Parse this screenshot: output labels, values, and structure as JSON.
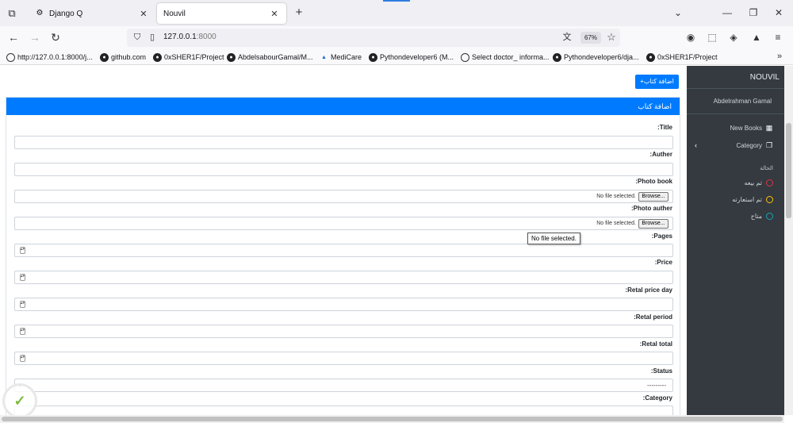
{
  "browser": {
    "tabs": [
      {
        "title": "Django Q",
        "active": false
      },
      {
        "title": "Nouvil",
        "active": true
      }
    ],
    "url_host": "127.0.0.1",
    "url_port": ":8000",
    "zoom": "67%",
    "bookmarks": [
      "http://127.0.0.1:8000/j...",
      "github.com",
      "0xSHER1F/Project",
      "AbdelsabourGamal/M...",
      "MediCare",
      "Pythondeveloper6 (M...",
      "Select doctor_ informa...",
      "Pythondeveloper6/dja...",
      "0xSHER1F/Project"
    ]
  },
  "sidebar": {
    "brand": "NOUVIL",
    "user": "Abdelrahman Gamal",
    "menu": [
      {
        "label": "New Books",
        "icon": "grid-icon"
      },
      {
        "label": "Category",
        "icon": "copy-icon"
      }
    ],
    "section_title": "الحالة",
    "legend": [
      {
        "label": "تم بيعه",
        "color": "#dc3545"
      },
      {
        "label": "تم استعارته",
        "color": "#ffc107"
      },
      {
        "label": "متاح",
        "color": "#17a2b8"
      }
    ]
  },
  "main": {
    "add_button": "+اضافة كتاب",
    "card_title": "اضافة كتاب",
    "fields": {
      "title": ":Title",
      "auther": ":Auther",
      "photo_book": ":Photo book",
      "photo_auther": ":Photo auther",
      "pages": ":Pages",
      "price": ":Price",
      "retal_price_day": ":Retal price day",
      "retal_period": ":Retal period",
      "retal_total": ":Retal total",
      "status": ":Status",
      "category": ":Category"
    },
    "file_status": "No file selected.",
    "browse_label": "Browse...",
    "status_value": "---------",
    "tooltip": "No file selected."
  },
  "colors": {
    "primary": "#007bff",
    "sidebar_bg": "#343a40"
  }
}
